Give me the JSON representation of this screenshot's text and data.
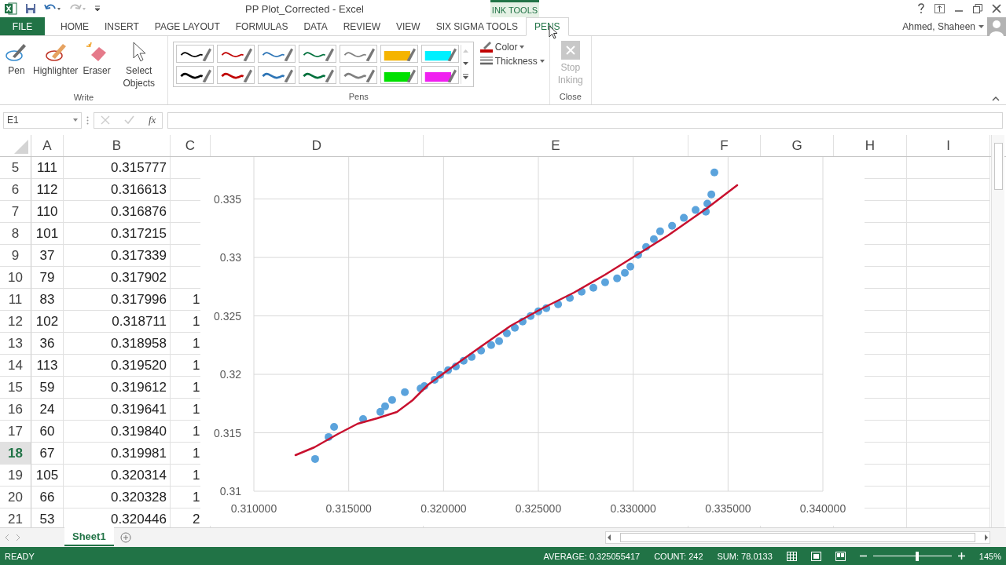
{
  "title_bar": {
    "title": "PP Plot_Corrected - Excel",
    "context_label": "INK TOOLS"
  },
  "ribbon_tabs": [
    {
      "label": "FILE",
      "kind": "file",
      "selected": false
    },
    {
      "label": "HOME",
      "kind": "tab",
      "selected": false
    },
    {
      "label": "INSERT",
      "kind": "tab",
      "selected": false
    },
    {
      "label": "PAGE LAYOUT",
      "kind": "tab",
      "selected": false
    },
    {
      "label": "FORMULAS",
      "kind": "tab",
      "selected": false
    },
    {
      "label": "DATA",
      "kind": "tab",
      "selected": false
    },
    {
      "label": "REVIEW",
      "kind": "tab",
      "selected": false
    },
    {
      "label": "VIEW",
      "kind": "tab",
      "selected": false
    },
    {
      "label": "SIX SIGMA TOOLS",
      "kind": "tab",
      "selected": false
    },
    {
      "label": "PENS",
      "kind": "context",
      "selected": true
    }
  ],
  "account": {
    "name": "Ahmed, Shaheen"
  },
  "write_group": {
    "label": "Write",
    "buttons": [
      {
        "label": "Pen",
        "kind": "pen"
      },
      {
        "label": "Highlighter",
        "kind": "highlighter"
      },
      {
        "label": "Eraser",
        "kind": "eraser"
      },
      {
        "label": "Select Objects",
        "kind": "select"
      }
    ]
  },
  "pens_group": {
    "label": "Pens",
    "color_button": "Color",
    "thickness_button": "Thickness",
    "pen_rows": [
      {
        "pens": [
          {
            "kind": "pen",
            "color": "#000000"
          },
          {
            "kind": "pen",
            "color": "#c00000"
          },
          {
            "kind": "pen",
            "color": "#2e75b6"
          },
          {
            "kind": "pen",
            "color": "#00703c"
          },
          {
            "kind": "pen",
            "color": "#808080"
          },
          {
            "kind": "highlighter",
            "color": "#f5b400"
          },
          {
            "kind": "highlighter",
            "color": "#00f0ff"
          }
        ]
      },
      {
        "pens": [
          {
            "kind": "pen",
            "color": "#000000"
          },
          {
            "kind": "pen",
            "color": "#c00000"
          },
          {
            "kind": "pen",
            "color": "#2e75b6"
          },
          {
            "kind": "pen",
            "color": "#00703c"
          },
          {
            "kind": "pen",
            "color": "#808080"
          },
          {
            "kind": "highlighter",
            "color": "#00e000"
          },
          {
            "kind": "highlighter",
            "color": "#f020f0"
          }
        ]
      }
    ]
  },
  "close_group": {
    "label": "Close",
    "stop_inking": {
      "label": "Stop Inking",
      "disabled": true
    }
  },
  "formula_bar": {
    "name_box": "E1",
    "function_label": "fx"
  },
  "columns": [
    "A",
    "B",
    "C",
    "D",
    "E",
    "F",
    "G",
    "H",
    "I"
  ],
  "rows": [
    {
      "header": "5",
      "a": "111",
      "b": "0.315777",
      "selected": false
    },
    {
      "header": "6",
      "a": "112",
      "b": "0.316613",
      "selected": false
    },
    {
      "header": "7",
      "a": "110",
      "b": "0.316876",
      "selected": false
    },
    {
      "header": "8",
      "a": "101",
      "b": "0.317215",
      "selected": false
    },
    {
      "header": "9",
      "a": "37",
      "b": "0.317339",
      "selected": false
    },
    {
      "header": "10",
      "a": "79",
      "b": "0.317902",
      "selected": false
    },
    {
      "header": "11",
      "a": "83",
      "b": "0.317996",
      "c": "1",
      "selected": false
    },
    {
      "header": "12",
      "a": "102",
      "b": "0.318711",
      "c": "1",
      "selected": false
    },
    {
      "header": "13",
      "a": "36",
      "b": "0.318958",
      "c": "1",
      "selected": false
    },
    {
      "header": "14",
      "a": "113",
      "b": "0.319520",
      "c": "1",
      "selected": false
    },
    {
      "header": "15",
      "a": "59",
      "b": "0.319612",
      "c": "1",
      "selected": false
    },
    {
      "header": "16",
      "a": "24",
      "b": "0.319641",
      "c": "1",
      "selected": false
    },
    {
      "header": "17",
      "a": "60",
      "b": "0.319840",
      "c": "1",
      "selected": false
    },
    {
      "header": "18",
      "a": "67",
      "b": "0.319981",
      "c": "1",
      "selected": true
    },
    {
      "header": "19",
      "a": "105",
      "b": "0.320314",
      "c": "1",
      "selected": false
    },
    {
      "header": "20",
      "a": "66",
      "b": "0.320328",
      "c": "1",
      "selected": false
    },
    {
      "header": "21",
      "a": "53",
      "b": "0.320446",
      "c": "2",
      "selected": false
    }
  ],
  "chart": {
    "chart_data": {
      "type": "scatter",
      "x": [
        0.31323,
        0.31394,
        0.31423,
        0.31576,
        0.31667,
        0.31692,
        0.31729,
        0.31796,
        0.31879,
        0.31899,
        0.31953,
        0.31982,
        0.32024,
        0.32065,
        0.32106,
        0.32148,
        0.32198,
        0.32251,
        0.32293,
        0.32334,
        0.32376,
        0.32417,
        0.32459,
        0.325,
        0.32542,
        0.32604,
        0.32666,
        0.32728,
        0.3279,
        0.32852,
        0.32915,
        0.32956,
        0.32985,
        0.33026,
        0.33068,
        0.33109,
        0.33142,
        0.33205,
        0.33267,
        0.33329,
        0.33383,
        0.33391,
        0.33412,
        0.33428
      ],
      "series": [
        {
          "color": "#5ba3dc",
          "values": [
            0.31276,
            0.31464,
            0.31551,
            0.31618,
            0.31679,
            0.31726,
            0.3178,
            0.31847,
            0.3188,
            0.319,
            0.31954,
            0.31995,
            0.32035,
            0.32068,
            0.32116,
            0.32149,
            0.32203,
            0.3225,
            0.32284,
            0.32351,
            0.32398,
            0.32452,
            0.32499,
            0.32539,
            0.32566,
            0.32599,
            0.32653,
            0.32707,
            0.3274,
            0.32787,
            0.32821,
            0.32868,
            0.32922,
            0.33023,
            0.3309,
            0.33157,
            0.33224,
            0.33271,
            0.33339,
            0.33406,
            0.33392,
            0.3346,
            0.3354,
            0.33728
          ]
        }
      ],
      "grid": true,
      "xlim": [
        0.31,
        0.34
      ],
      "ylim": [
        0.31,
        0.3386
      ],
      "xticks": [
        {
          "value": 0.31,
          "label": "0.310000"
        },
        {
          "value": 0.315,
          "label": "0.315000"
        },
        {
          "value": 0.32,
          "label": "0.320000"
        },
        {
          "value": 0.325,
          "label": "0.325000"
        },
        {
          "value": 0.33,
          "label": "0.330000"
        },
        {
          "value": 0.335,
          "label": "0.335000"
        },
        {
          "value": 0.34,
          "label": "0.340000"
        }
      ],
      "yticks": [
        0.31,
        0.315,
        0.32,
        0.325,
        0.33,
        0.335
      ]
    }
  },
  "sheet_tabs": [
    {
      "label": "Sheet1",
      "selected": true
    }
  ],
  "status_bar": {
    "mode": "READY",
    "average": "AVERAGE: 0.325055417",
    "count": "COUNT: 242",
    "sum": "SUM: 78.0133",
    "zoom": "145%",
    "zoom_slider": {
      "level": 0.56
    }
  }
}
